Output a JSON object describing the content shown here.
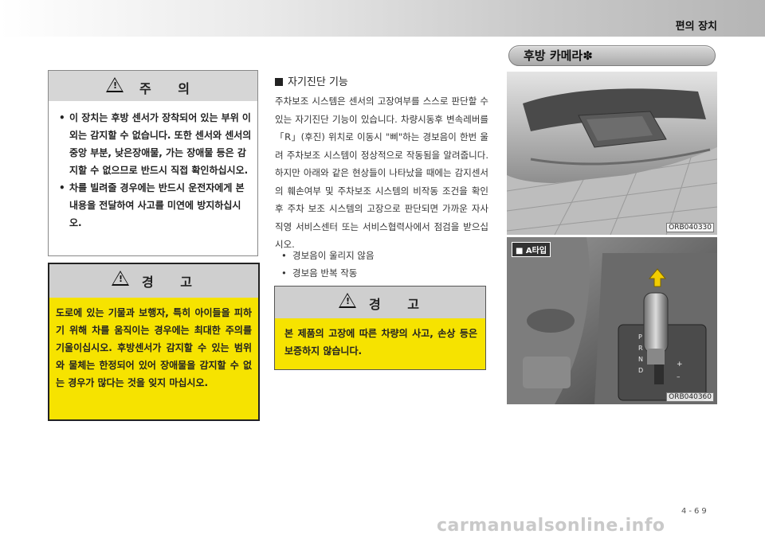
{
  "header": {
    "title": "편의 장치"
  },
  "section": {
    "title": "후방 카메라✽"
  },
  "caution": {
    "icon": "warning-triangle-icon",
    "title": "주 의",
    "items": [
      "이 장치는 후방 센서가 장착되어 있는 부위 이외는 감지할 수 없습니다. 또한 센서와 센서의 중앙 부분, 낮은장애물, 가는 장애물 등은 감지할 수 없으므로 반드시 직접 확인하십시오.",
      "차를 빌려줄 경우에는 반드시 운전자에게 본 내용을 전달하여 사고를 미연에 방지하십시오."
    ]
  },
  "warning_left": {
    "icon": "warning-triangle-icon",
    "title": "경 고",
    "text": "도로에 있는 기물과 보행자, 특히 아이들을 피하기 위해 차를 움직이는 경우에는 최대한 주의를 기울이십시오. 후방센서가 감지할 수 있는 범위와 물체는 한정되어 있어 장애물을 감지할 수 없는 경우가 많다는 것을 잊지 마십시오."
  },
  "self_diag": {
    "title": "자기진단 기능",
    "body": "주차보조 시스템은 센서의 고장여부를 스스로 판단할 수 있는 자기진단 기능이 있습니다. 차량시동후 변속레버를 「R」(후진) 위치로 이동시 \"삐\"하는 경보음이 한번 울려 주차보조 시스템이 정상적으로 작동됨을 알려줍니다. 하지만 아래와 같은 현상들이 나타났을 때에는 감지센서의 훼손여부 및 주차보조 시스템의 비작동 조건을 확인 후 주차 보조 시스템의 고장으로 판단되면 가까운 자사 직영 서비스센터 또는 서비스협력사에서 점검을 받으십시오.",
    "bullets": [
      "경보음이 울리지 않음",
      "경보음 반복 작동"
    ]
  },
  "warning_mid": {
    "icon": "warning-triangle-icon",
    "title": "경 고",
    "text": "본 제품의 고장에 따른 차량의 사고, 손상 등은 보증하지 않습니다."
  },
  "figures": [
    {
      "code": "ORB040330"
    },
    {
      "code": "ORB040360",
      "badge": "■ A타입",
      "gear_labels": [
        "P",
        "R",
        "N",
        "D",
        "+",
        "–"
      ]
    }
  ],
  "page_number": "4-69",
  "watermark": "carmanualsonline.info"
}
